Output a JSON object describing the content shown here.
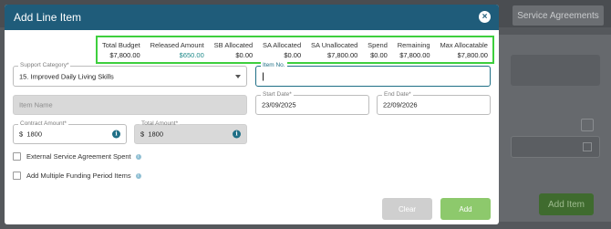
{
  "background": {
    "tab_label": "Service Agreements",
    "add_item_label": "Add Item"
  },
  "modal": {
    "title": "Add Line Item",
    "close_icon": "close-icon"
  },
  "summary": [
    {
      "label": "Total Budget",
      "value": "$7,800.00"
    },
    {
      "label": "Released Amount",
      "value": "$650.00"
    },
    {
      "label": "SB Allocated",
      "value": "$0.00"
    },
    {
      "label": "SA Allocated",
      "value": "$0.00"
    },
    {
      "label": "SA Unallocated",
      "value": "$7,800.00"
    },
    {
      "label": "Spend",
      "value": "$0.00"
    },
    {
      "label": "Remaining",
      "value": "$7,800.00"
    },
    {
      "label": "Max Allocatable",
      "value": "$7,800.00"
    }
  ],
  "form": {
    "support_category": {
      "label": "Support Category*",
      "value": "15. Improved Daily Living Skills"
    },
    "item_no": {
      "label": "Item No.",
      "value": ""
    },
    "item_name": {
      "placeholder": "Item Name"
    },
    "start_date": {
      "label": "Start Date*",
      "value": "23/09/2025"
    },
    "end_date": {
      "label": "End Date*",
      "value": "22/09/2026"
    },
    "contract_amount": {
      "label": "Contract Amount*",
      "currency": "$",
      "value": "1800"
    },
    "total_amount": {
      "label": "Total Amount*",
      "currency": "$",
      "value": "1800"
    },
    "external_spent": {
      "label": "External Service Agreement Spent"
    },
    "multiple_funding": {
      "label": "Add Multiple Funding Period Items"
    }
  },
  "buttons": {
    "clear": "Clear",
    "add": "Add"
  },
  "colors": {
    "header": "#1f5c7a",
    "summary_border": "#3ecf3e",
    "add_button": "#8dc96c",
    "released_value": "#1f8a8a"
  }
}
